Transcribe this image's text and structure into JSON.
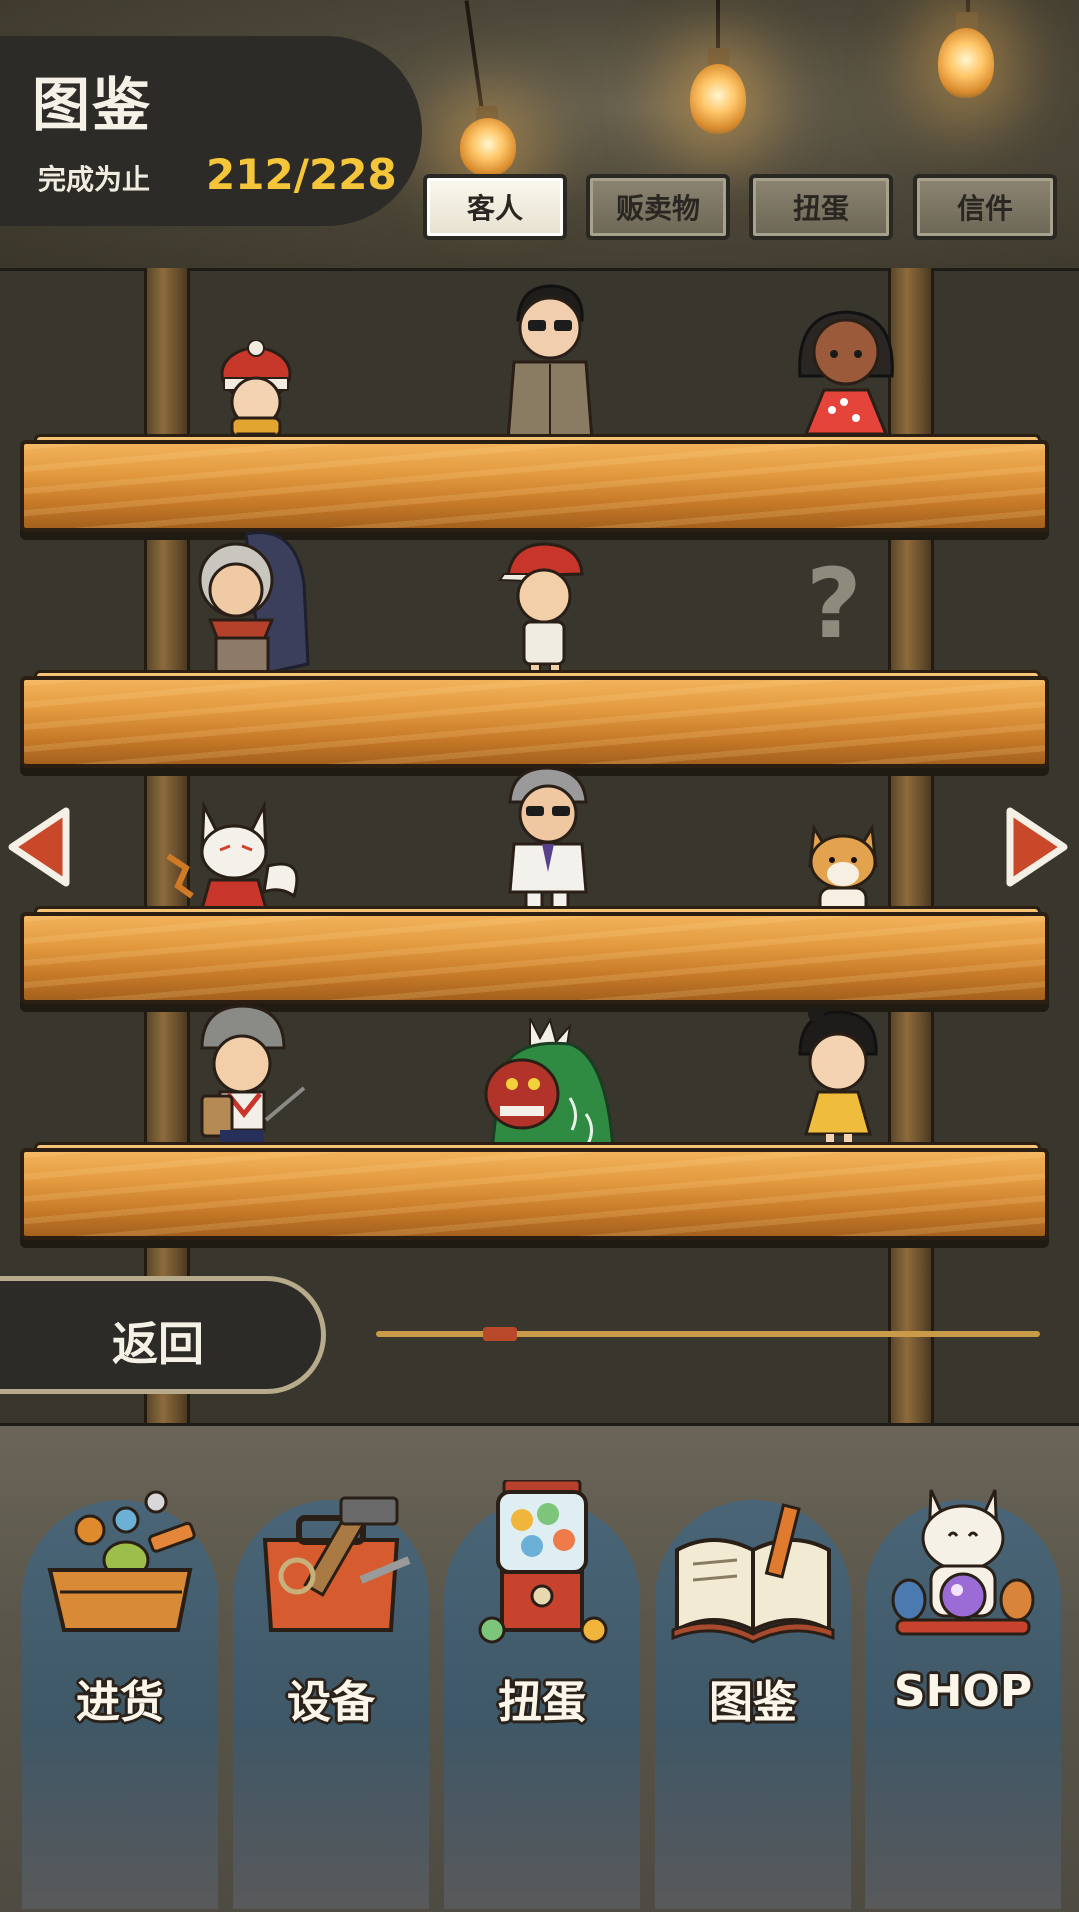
{
  "header": {
    "title": "图鉴",
    "progress_label": "完成为止",
    "progress_value": "212/228"
  },
  "tabs": [
    {
      "label": "客人",
      "active": true
    },
    {
      "label": "贩卖物",
      "active": false
    },
    {
      "label": "扭蛋",
      "active": false
    },
    {
      "label": "信件",
      "active": false
    }
  ],
  "shelves": [
    {
      "row": 1,
      "items": [
        {
          "icon": "child-in-beanie-and-scarf-figure",
          "unlocked": true
        },
        {
          "icon": "man-in-trench-coat-and-sunglasses-figure",
          "unlocked": true
        },
        {
          "icon": "girl-in-polka-dot-dress-figure",
          "unlocked": true
        }
      ]
    },
    {
      "row": 2,
      "items": [
        {
          "icon": "old-woman-with-bundle-figure",
          "unlocked": true
        },
        {
          "icon": "boy-in-red-cap-figure",
          "unlocked": true
        },
        {
          "icon": "unknown-question-mark",
          "unlocked": false,
          "mark": "?"
        }
      ]
    },
    {
      "row": 3,
      "items": [
        {
          "icon": "fox-mask-girl-figure",
          "unlocked": true
        },
        {
          "icon": "man-in-white-suit-figure",
          "unlocked": true
        },
        {
          "icon": "shiba-dog-figure",
          "unlocked": true
        }
      ]
    },
    {
      "row": 4,
      "items": [
        {
          "icon": "boy-with-shield-and-sword-figure",
          "unlocked": true
        },
        {
          "icon": "lion-dance-mask-figure",
          "unlocked": true
        },
        {
          "icon": "girl-in-yellow-dress-figure",
          "unlocked": true
        }
      ]
    }
  ],
  "navigation": {
    "prev_icon": "left-arrow-icon",
    "next_icon": "right-arrow-icon",
    "back_label": "返回",
    "scroll_position": 0.17
  },
  "bottom_nav": [
    {
      "label": "进货",
      "icon": "goods-crate-icon"
    },
    {
      "label": "设备",
      "icon": "toolbox-icon"
    },
    {
      "label": "扭蛋",
      "icon": "gacha-machine-icon"
    },
    {
      "label": "图鉴",
      "icon": "open-book-icon"
    },
    {
      "label": "SHOP",
      "icon": "lucky-cat-icon"
    }
  ],
  "colors": {
    "accent_yellow": "#f5c53a",
    "panel_dark": "#2c2b27",
    "shelf_wood": "#e39a3f",
    "arrow_red": "#c9482a",
    "nav_blue": "#496577"
  }
}
